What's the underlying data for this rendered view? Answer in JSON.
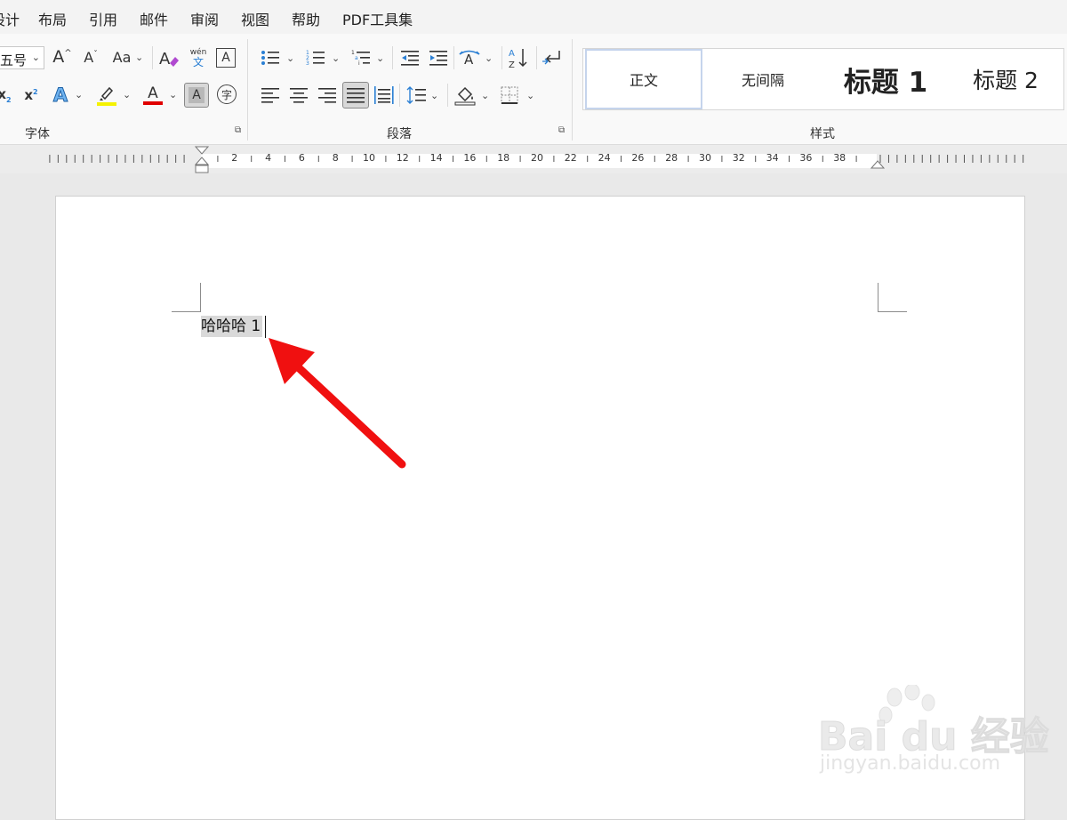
{
  "menu": {
    "items": [
      "设计",
      "布局",
      "引用",
      "邮件",
      "审阅",
      "视图",
      "帮助",
      "PDF工具集"
    ]
  },
  "ribbon": {
    "font_group": {
      "label": "字体",
      "font_size": "五号",
      "increase_font": "A",
      "decrease_font": "A",
      "change_case": "Aa",
      "phonetic_top": "wén",
      "phonetic_bottom": "文",
      "char_border": "A",
      "subscript": "x",
      "superscript": "x",
      "text_effect": "A",
      "font_color": "A",
      "char_shading": "A",
      "enclose_char": "字"
    },
    "paragraph_group": {
      "label": "段落"
    },
    "styles_group": {
      "label": "样式",
      "styles": [
        "正文",
        "无间隔",
        "标题 1",
        "标题 2"
      ]
    }
  },
  "ruler": {
    "labels": [
      "2",
      "4",
      "6",
      "8",
      "10",
      "12",
      "14",
      "16",
      "18",
      "20",
      "22",
      "24",
      "26",
      "28",
      "30",
      "32",
      "34",
      "36",
      "38"
    ]
  },
  "document": {
    "text": "哈哈哈 1"
  },
  "watermark": {
    "brand": "Bai du 经验",
    "url": "jingyan.baidu.com"
  },
  "colors": {
    "highlight": "#f5f200",
    "font_color": "#e00000",
    "text_effect": "#2a7fd4",
    "arrow": "#f01010",
    "selection": "#d9d9d9"
  }
}
